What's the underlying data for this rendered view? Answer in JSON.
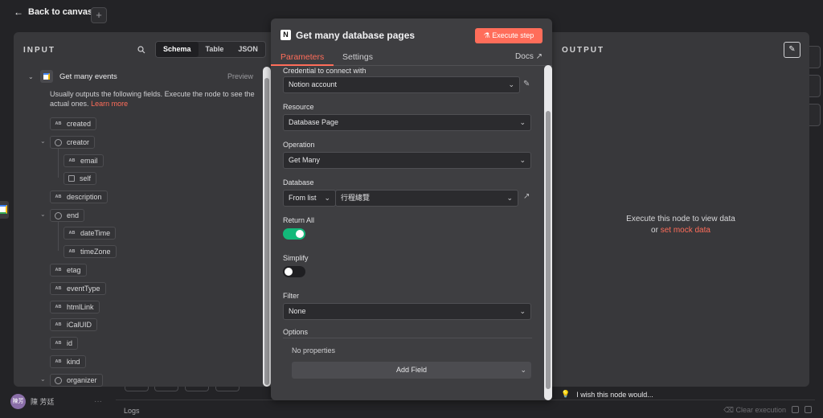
{
  "topbar": {
    "back_label": "Back to canvas",
    "plus_label": "+"
  },
  "user": {
    "avatar_text": "陳芳",
    "name": "陳 芳廷",
    "menu": "···"
  },
  "logs": {
    "label": "Logs",
    "clear_label": "Clear execution"
  },
  "input": {
    "title": "INPUT",
    "tabs": [
      "Schema",
      "Table",
      "JSON"
    ],
    "active_tab": "Schema",
    "node_name": "Get many events",
    "preview_label": "Preview",
    "hint": "Usually outputs the following fields. Execute the node to see the actual ones.",
    "learn_more": "Learn more",
    "fields": [
      {
        "name": "created",
        "type": "string"
      },
      {
        "name": "creator",
        "type": "object"
      },
      {
        "name": "email",
        "type": "string"
      },
      {
        "name": "self",
        "type": "boolean"
      },
      {
        "name": "description",
        "type": "string"
      },
      {
        "name": "end",
        "type": "object"
      },
      {
        "name": "dateTime",
        "type": "string"
      },
      {
        "name": "timeZone",
        "type": "string"
      },
      {
        "name": "etag",
        "type": "string"
      },
      {
        "name": "eventType",
        "type": "string"
      },
      {
        "name": "htmlLink",
        "type": "string"
      },
      {
        "name": "iCalUID",
        "type": "string"
      },
      {
        "name": "id",
        "type": "string"
      },
      {
        "name": "kind",
        "type": "string"
      },
      {
        "name": "organizer",
        "type": "object"
      }
    ],
    "type_badge": "AB"
  },
  "node": {
    "title": "Get many database pages",
    "execute_label": "Execute step",
    "tabs": [
      "Parameters",
      "Settings"
    ],
    "active_tab": "Parameters",
    "docs_label": "Docs",
    "credential_label": "Credential to connect with",
    "credential_value": "Notion account",
    "resource_label": "Resource",
    "resource_value": "Database Page",
    "operation_label": "Operation",
    "operation_value": "Get Many",
    "database_label": "Database",
    "database_mode": "From list",
    "database_value": "行程總覽",
    "return_all_label": "Return All",
    "return_all_on": true,
    "simplify_label": "Simplify",
    "simplify_on": false,
    "filter_label": "Filter",
    "filter_value": "None",
    "options_label": "Options",
    "no_properties": "No properties",
    "add_field_label": "Add Field"
  },
  "output": {
    "title": "OUTPUT",
    "message": "Execute this node to view data",
    "or_text": "or",
    "mock_link": "set mock data",
    "wish_text": "I wish this node would..."
  },
  "colors": {
    "accent": "#ff6d5a",
    "toggle_on": "#13b97a"
  }
}
